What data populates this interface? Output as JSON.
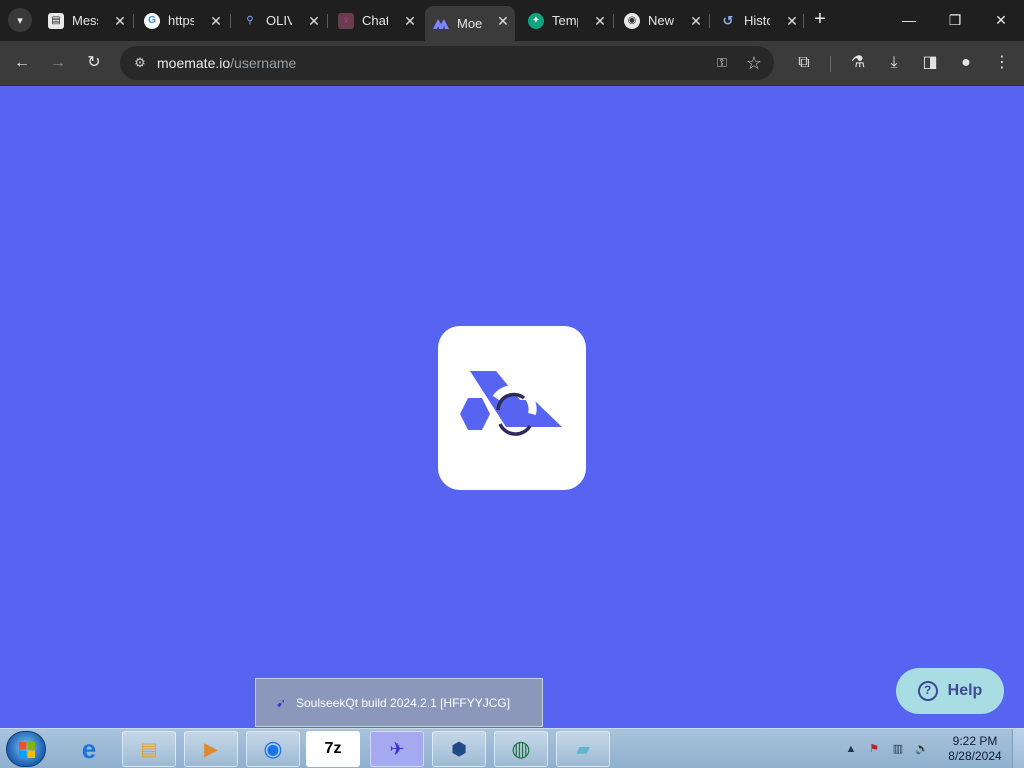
{
  "tabs": [
    {
      "title": "Messages",
      "favicon": "page-icon"
    },
    {
      "title": "https://",
      "favicon": "google-icon"
    },
    {
      "title": "OLIVIA",
      "favicon": "search-icon"
    },
    {
      "title": "Chat",
      "favicon": "character-icon"
    },
    {
      "title": "Moemate",
      "favicon": "moemate-icon",
      "active": true
    },
    {
      "title": "Templates",
      "favicon": "template-icon"
    },
    {
      "title": "New Tab",
      "favicon": "chrome-icon"
    },
    {
      "title": "History",
      "favicon": "history-icon"
    }
  ],
  "address_bar": {
    "host": "moemate.io",
    "path": "/username"
  },
  "help_button": {
    "label": "Help"
  },
  "taskbar": {
    "preview_title": "SoulseekQt build 2024.2.1 [HFFYYJCG]",
    "apps": [
      "explorer-icon",
      "ie-icon",
      "folder-icon",
      "media-player-icon",
      "chrome-icon",
      "7zip-icon",
      "soulseek-icon",
      "virtualbox-icon",
      "network-icon",
      "notepad-icon"
    ],
    "clock_time": "9:22 PM",
    "clock_date": "8/28/2024"
  },
  "colors": {
    "page_background": "#5764f2",
    "logo_color": "#5764f2",
    "help_bg": "#a9dde4"
  }
}
